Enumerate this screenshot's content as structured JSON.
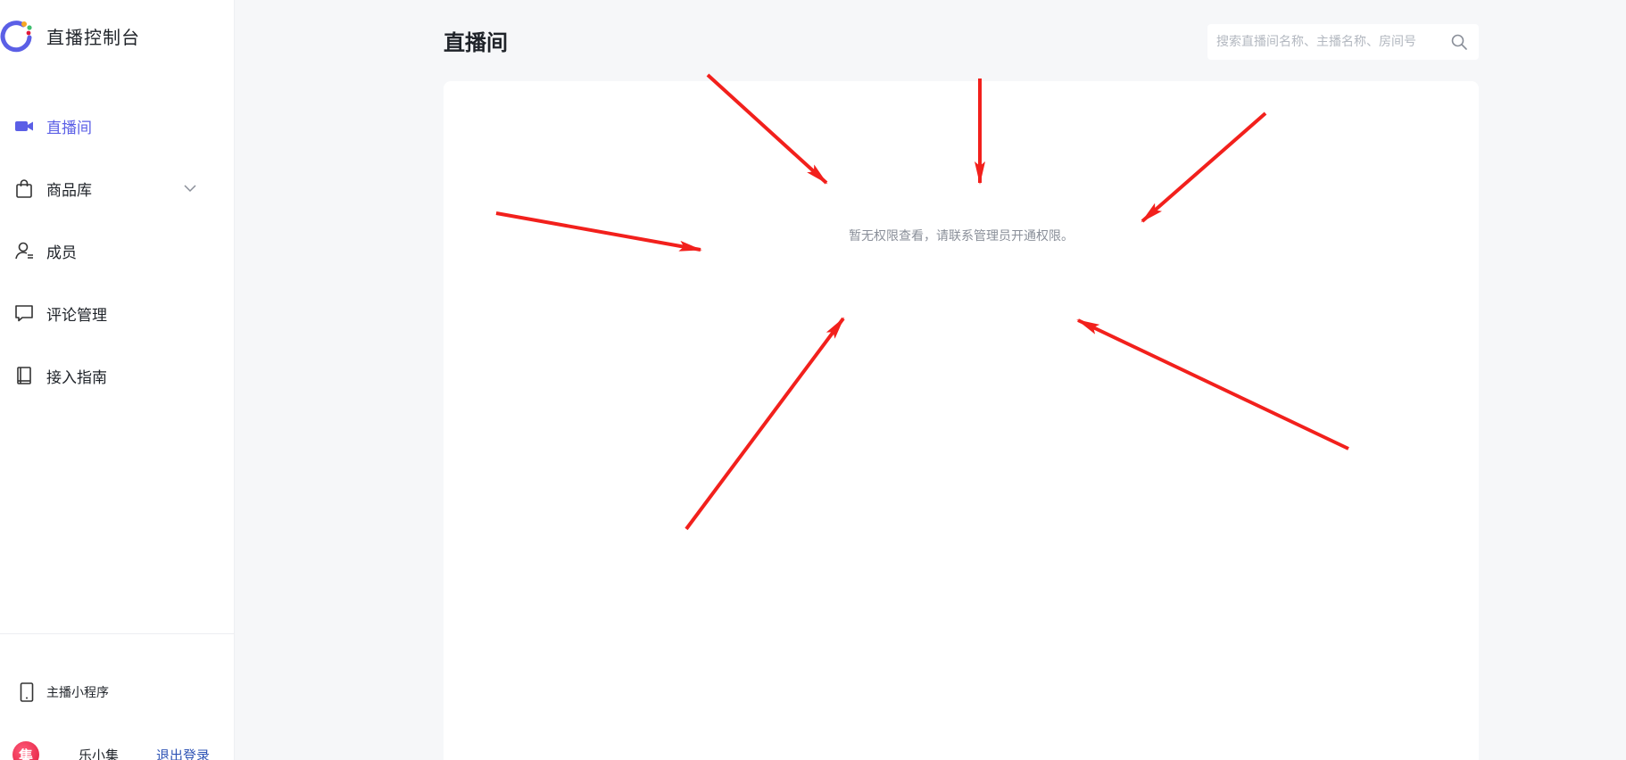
{
  "sidebar": {
    "brand": {
      "title": "直播控制台"
    },
    "items": [
      {
        "label": "直播间",
        "icon": "video-camera-icon",
        "active": true
      },
      {
        "label": "商品库",
        "icon": "shopping-bag-icon",
        "has_submenu": true
      },
      {
        "label": "成员",
        "icon": "member-icon"
      },
      {
        "label": "评论管理",
        "icon": "comment-icon"
      },
      {
        "label": "接入指南",
        "icon": "book-icon"
      }
    ],
    "mini_program": {
      "label": "主播小程序",
      "icon": "phone-icon"
    },
    "user": {
      "avatar_text": "集",
      "name": "乐小集",
      "logout_label": "退出登录"
    }
  },
  "main": {
    "title": "直播间",
    "search": {
      "placeholder": "搜索直播间名称、主播名称、房间号",
      "value": ""
    },
    "empty_message": "暂无权限查看，请联系管理员开通权限。"
  },
  "colors": {
    "accent": "#5b5fe6",
    "annotation_arrow": "#f2201c",
    "background": "#f6f7f9"
  }
}
